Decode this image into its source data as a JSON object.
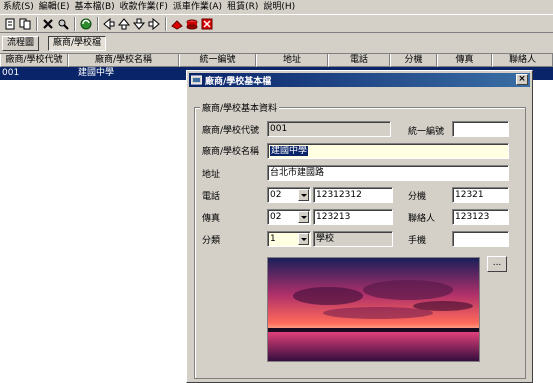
{
  "menu": [
    "系統(S)",
    "編輯(E)",
    "基本檔(B)",
    "收款作業(F)",
    "派車作業(A)",
    "租賃(R)",
    "說明(H)"
  ],
  "toolbar": {
    "icons": [
      "new-icon",
      "copy-icon",
      "delete-icon",
      "find-icon",
      "refresh-icon",
      "first-record-icon",
      "prev-record-icon",
      "next-record-icon",
      "last-record-icon",
      "save-icon",
      "cancel-icon",
      "exit-icon"
    ]
  },
  "tabs": [
    "流程圖",
    "廠商/學校檔"
  ],
  "grid": {
    "headers": [
      "廠商/學校代號",
      "廠商/學校名稱",
      "統一編號",
      "地址",
      "電話",
      "分機",
      "傳真",
      "聯絡人"
    ],
    "rows": [
      [
        "001",
        "建國中學",
        "",
        "",
        "",
        "",
        "",
        ""
      ]
    ]
  },
  "dialog": {
    "title": "廠商/學校基本檔",
    "group_title": "廠商/學校基本資料",
    "labels": {
      "code": "廠商/學校代號",
      "name": "廠商/學校名稱",
      "address": "地址",
      "phone": "電話",
      "fax": "傳真",
      "category": "分類",
      "tax_id": "統一編號",
      "ext": "分機",
      "contact": "聯絡人",
      "mobile": "手機"
    },
    "values": {
      "code": "001",
      "name": "建國中學",
      "address": "台北市建國路",
      "phone_area": "02",
      "phone": "12312312",
      "fax_area": "02",
      "fax": "123213",
      "category_code": "1",
      "category_name": "學校",
      "tax_id": "",
      "ext": "12321",
      "contact": "123123",
      "mobile": ""
    },
    "browse_label": "...",
    "close_label": "×"
  },
  "colors": {
    "selection": "#0a246a",
    "face": "#d4d0c8",
    "highlight_field": "#ffffe1"
  }
}
